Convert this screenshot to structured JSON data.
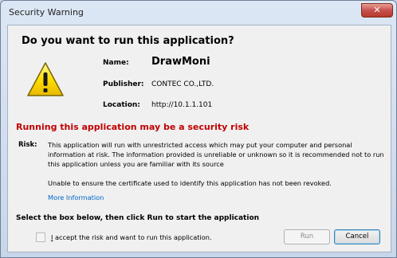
{
  "window": {
    "title": "Security Warning",
    "close_glyph": "✕"
  },
  "dialog": {
    "heading": "Do you want to run this application?",
    "icon": "warning-triangle-icon",
    "info": {
      "name_label": "Name:",
      "name_value": "DrawMoni",
      "publisher_label": "Publisher:",
      "publisher_value": "CONTEC CO.,LTD.",
      "location_label": "Location:",
      "location_value": "http://10.1.1.101"
    },
    "risk": {
      "title": "Running this application may be a security risk",
      "label": "Risk:",
      "description": "This application will run with unrestricted access which may put your computer and personal information at risk. The information provided is unreliable or unknown so it is recommended not to run this application unless you are familiar with its source",
      "certificate_note": "Unable to ensure the certificate used to identify this application has not been revoked.",
      "more_info_link": "More Information"
    },
    "accept": {
      "heading": "Select the box below, then click Run to start the application",
      "checkbox_label_underlined": "I",
      "checkbox_label_rest": " accept the risk and want to run this application.",
      "checked": false
    },
    "buttons": {
      "run_label": "Run",
      "cancel_label": "Cancel"
    }
  },
  "colors": {
    "risk_red": "#c00000",
    "link_blue": "#0066cc",
    "close_red": "#c75050",
    "warning_yellow": "#ffe000"
  }
}
